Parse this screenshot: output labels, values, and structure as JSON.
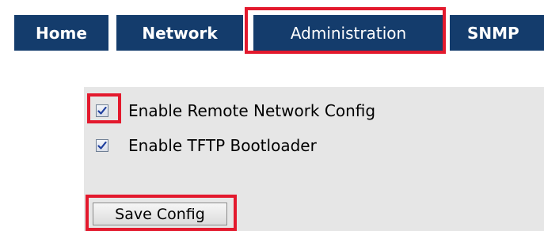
{
  "nav": {
    "tabs": [
      {
        "label": "Home"
      },
      {
        "label": "Network"
      },
      {
        "label": "Administration",
        "active": true
      },
      {
        "label": "SNMP"
      }
    ]
  },
  "form": {
    "remote_config": {
      "label": "Enable Remote Network Config",
      "checked": true
    },
    "tftp_bootloader": {
      "label": "Enable TFTP Bootloader",
      "checked": true
    },
    "save_button": {
      "label": "Save Config"
    }
  },
  "colors": {
    "tab_background": "#143c6c",
    "tab_text": "#ffffff",
    "highlight": "#e3192d",
    "panel_background": "#e6e6e6"
  }
}
